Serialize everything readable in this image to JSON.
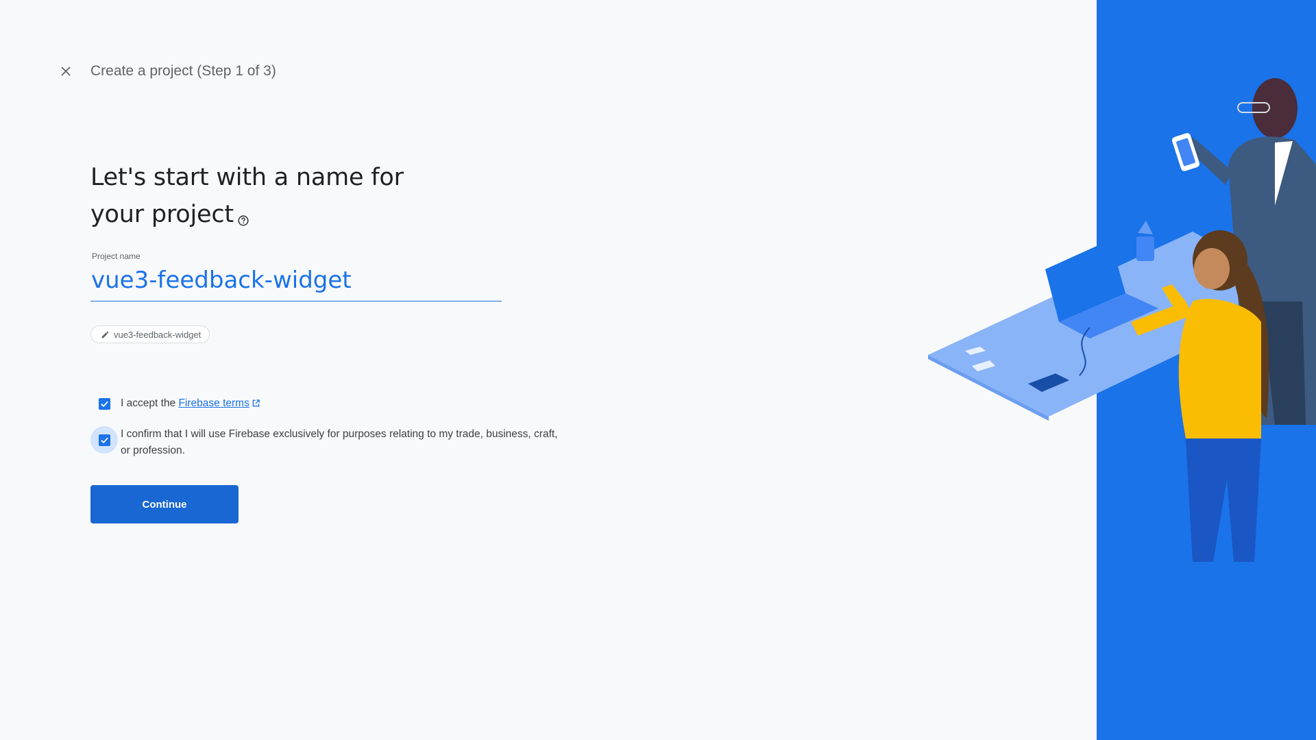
{
  "header": {
    "title": "Create a project (Step 1 of 3)",
    "close_icon": "close-icon"
  },
  "main": {
    "heading_line1": "Let's start with a name for",
    "heading_line2": "your project",
    "help_icon": "help-circle-icon"
  },
  "project_name": {
    "label": "Project name",
    "value": "vue3-feedback-widget"
  },
  "project_id_chip": {
    "text": "vue3-feedback-widget",
    "icon": "pencil-icon"
  },
  "terms": {
    "accept_prefix": "I accept the",
    "link_text": "Firebase terms",
    "link_icon": "external-link-icon",
    "checked": true
  },
  "confirm": {
    "text": "I confirm that I will use Firebase exclusively for purposes relating to my trade, business, craft, or profession.",
    "checked": true
  },
  "continue_label": "Continue",
  "colors": {
    "accent": "#1a73e8",
    "button": "#1967d2",
    "panel": "#1a73e8",
    "background": "#f8f9fa"
  }
}
